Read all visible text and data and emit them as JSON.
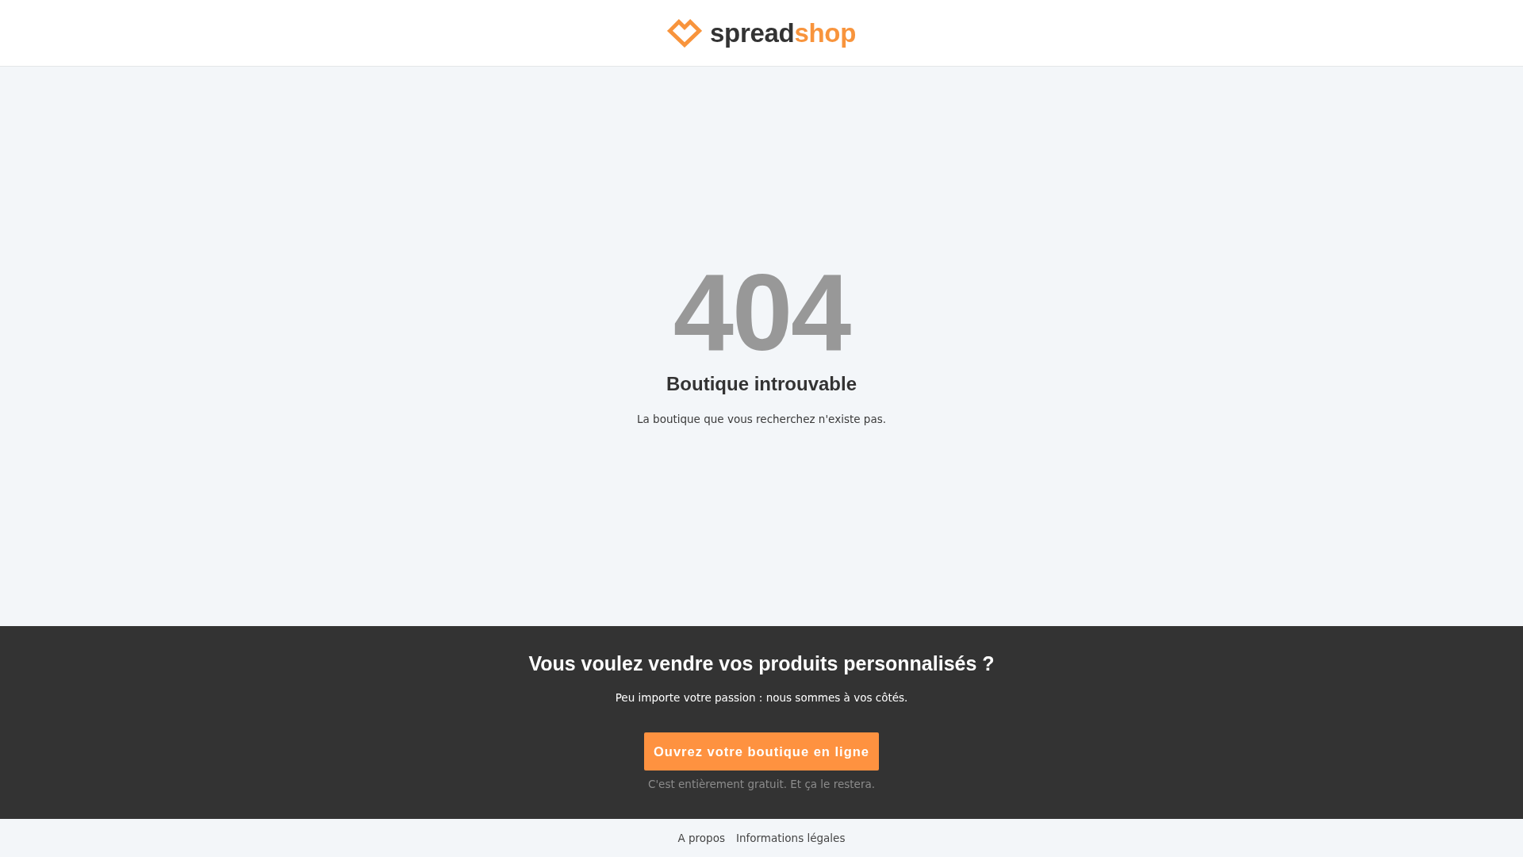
{
  "header": {
    "logo": {
      "parts": [
        {
          "text": "spread",
          "color": "#333333"
        },
        {
          "text": "shop",
          "color": "#f8943c"
        }
      ]
    }
  },
  "error": {
    "code": "404",
    "title": "Boutique introuvable",
    "message": "La boutique que vous recherchez n'existe pas."
  },
  "promo": {
    "title": "Vous voulez vendre vos produits personnalisés ?",
    "subtitle": "Peu importe votre passion : nous sommes à vos côtés.",
    "button": "Ouvrez votre boutique en ligne",
    "note": "C'est entièrement gratuit. Et ça le restera."
  },
  "footer": {
    "links": [
      "A propos",
      "Informations légales"
    ]
  }
}
